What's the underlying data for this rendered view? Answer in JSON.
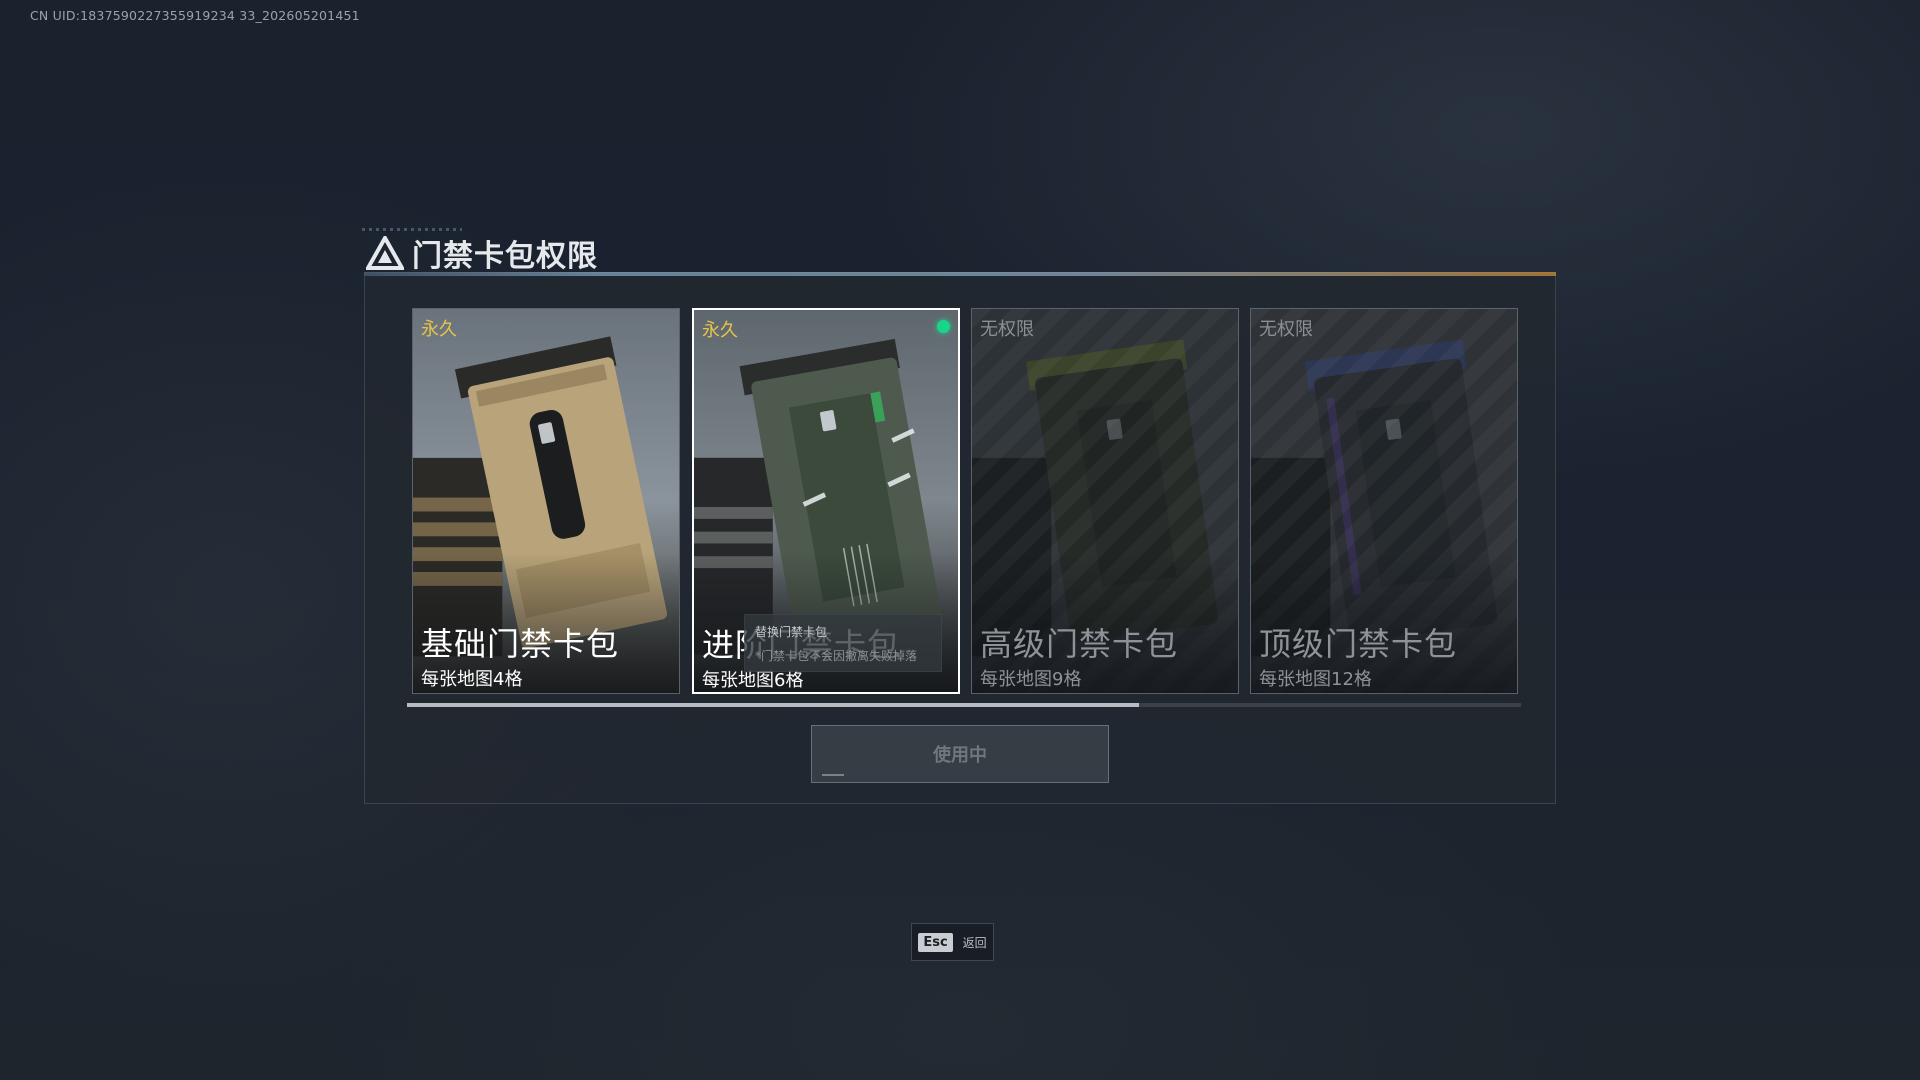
{
  "uid_text": "CN UID:1837590227355919234 33_202605201451",
  "dialog": {
    "title": "门禁卡包权限",
    "icon": "warning-triangle-icon"
  },
  "cards": [
    {
      "tag": "永久",
      "name": "基础门禁卡包",
      "sub": "每张地图4格",
      "status": "permanent",
      "accent": "#b8a37a"
    },
    {
      "tag": "永久",
      "name": "进阶门禁卡包",
      "sub": "每张地图6格",
      "status": "in-use",
      "accent": "#6b8a66"
    },
    {
      "tag": "无权限",
      "name": "高级门禁卡包",
      "sub": "每张地图9格",
      "status": "locked",
      "accent": "#6c7a3e"
    },
    {
      "tag": "无权限",
      "name": "顶级门禁卡包",
      "sub": "每张地图12格",
      "status": "locked",
      "accent": "#4d5e9a"
    }
  ],
  "tooltip": {
    "title": "替换门禁卡包",
    "desc": "*门禁卡包不会因撤离失败掉落"
  },
  "scrollbar_fraction": 0.657,
  "use_button": {
    "label": "使用中"
  },
  "esc": {
    "key": "Esc",
    "label": "返回"
  },
  "colors": {
    "permanent_tag": "#e7c34a",
    "active_dot": "#19d48a",
    "locked_text": "#8d9399"
  }
}
